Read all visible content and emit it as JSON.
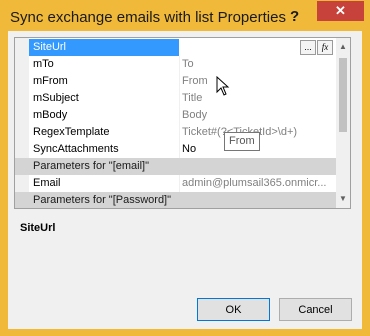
{
  "window": {
    "title": "Sync exchange emails with list Properties",
    "help_glyph": "?",
    "close_glyph": "✕"
  },
  "grid": {
    "rows": [
      {
        "name": "SiteUrl",
        "value": "",
        "value_color": "#000000",
        "selected": true
      },
      {
        "name": "mTo",
        "value": "To",
        "value_color": "#808080"
      },
      {
        "name": "mFrom",
        "value": "From",
        "value_color": "#808080"
      },
      {
        "name": "mSubject",
        "value": "Title",
        "value_color": "#808080"
      },
      {
        "name": "mBody",
        "value": "Body",
        "value_color": "#808080"
      },
      {
        "name": "RegexTemplate",
        "value": "Ticket#(?<TicketId>\\d+)",
        "value_color": "#808080"
      },
      {
        "name": "SyncAttachments",
        "value": "No",
        "value_color": "#000000"
      }
    ],
    "category_email": "Parameters for \"[email]\"",
    "email_row": {
      "name": "Email",
      "value": "admin@plumsail365.onmicr..."
    },
    "category_password": "Parameters for \"[Password]\"",
    "ellipsis_label": "...",
    "fx_label": "fx"
  },
  "tooltip": "From",
  "description": {
    "title": "SiteUrl"
  },
  "buttons": {
    "ok": "OK",
    "cancel": "Cancel"
  }
}
